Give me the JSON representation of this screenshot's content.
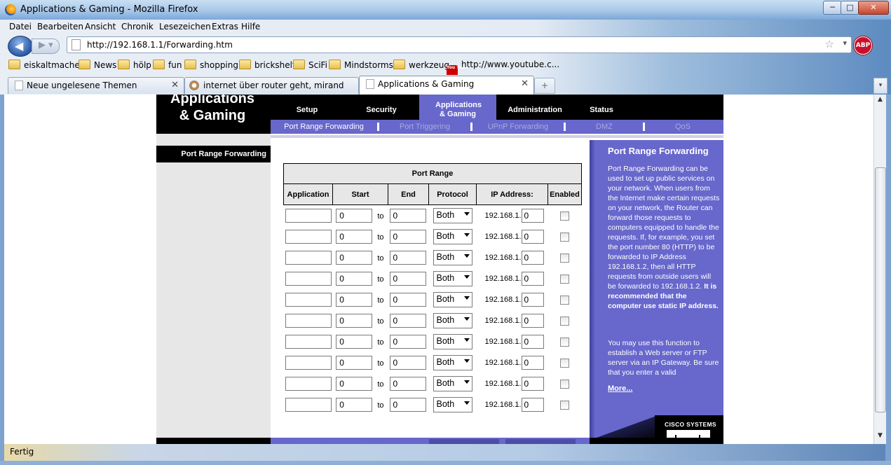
{
  "window": {
    "title": "Applications & Gaming - Mozilla Firefox",
    "min_label": "─",
    "max_label": "□",
    "close_label": "✕"
  },
  "menu": [
    "Datei",
    "Bearbeiten",
    "Ansicht",
    "Chronik",
    "Lesezeichen",
    "Extras",
    "Hilfe"
  ],
  "navbar": {
    "url": "http://192.168.1.1/Forwarding.htm",
    "adblock_label": "ABP"
  },
  "bookmarks": [
    {
      "label": "eiskaltmacher",
      "icon": "folder-icon"
    },
    {
      "label": "News",
      "icon": "folder-icon"
    },
    {
      "label": "hölp",
      "icon": "folder-icon"
    },
    {
      "label": "fun",
      "icon": "folder-icon"
    },
    {
      "label": "shopping",
      "icon": "folder-icon"
    },
    {
      "label": "brickshelf",
      "icon": "folder-icon"
    },
    {
      "label": "SciFi",
      "icon": "folder-icon"
    },
    {
      "label": "Mindstorms",
      "icon": "folder-icon"
    },
    {
      "label": "werkzeug",
      "icon": "folder-icon"
    },
    {
      "label": "http://www.youtube.c...",
      "icon": "youtube-icon"
    }
  ],
  "youtube_icon_text": "You Tube",
  "tabs": [
    {
      "label": "Neue ungelesene Themen",
      "active": false
    },
    {
      "label": "internet über router geht, miranda a...",
      "active": false
    },
    {
      "label": "Applications & Gaming",
      "active": true
    }
  ],
  "new_tab_label": "+",
  "status": "Fertig",
  "router": {
    "section_title": "Applications & Gaming",
    "main_tabs": [
      "Setup",
      "Security",
      "Applications & Gaming",
      "Administration",
      "Status"
    ],
    "active_main_tab": "Applications & Gaming",
    "sub_tabs": [
      "Port Range Forwarding",
      "Port Triggering",
      "UPnP Forwarding",
      "DMZ",
      "QoS"
    ],
    "active_sub_tab": "Port Range Forwarding",
    "left_label": "Port Range Forwarding",
    "table": {
      "group_header": "Port Range",
      "headers": [
        "Application",
        "Start",
        "End",
        "Protocol",
        "IP Address:",
        "Enabled"
      ],
      "to_label": "to",
      "ip_prefix": "192.168.1.",
      "rows": [
        {
          "application": "",
          "start": "0",
          "end": "0",
          "protocol": "Both",
          "ip_last": "0",
          "enabled": false
        },
        {
          "application": "",
          "start": "0",
          "end": "0",
          "protocol": "Both",
          "ip_last": "0",
          "enabled": false
        },
        {
          "application": "",
          "start": "0",
          "end": "0",
          "protocol": "Both",
          "ip_last": "0",
          "enabled": false
        },
        {
          "application": "",
          "start": "0",
          "end": "0",
          "protocol": "Both",
          "ip_last": "0",
          "enabled": false
        },
        {
          "application": "",
          "start": "0",
          "end": "0",
          "protocol": "Both",
          "ip_last": "0",
          "enabled": false
        },
        {
          "application": "",
          "start": "0",
          "end": "0",
          "protocol": "Both",
          "ip_last": "0",
          "enabled": false
        },
        {
          "application": "",
          "start": "0",
          "end": "0",
          "protocol": "Both",
          "ip_last": "0",
          "enabled": false
        },
        {
          "application": "",
          "start": "0",
          "end": "0",
          "protocol": "Both",
          "ip_last": "0",
          "enabled": false
        },
        {
          "application": "",
          "start": "0",
          "end": "0",
          "protocol": "Both",
          "ip_last": "0",
          "enabled": false
        },
        {
          "application": "",
          "start": "0",
          "end": "0",
          "protocol": "Both",
          "ip_last": "0",
          "enabled": false
        }
      ]
    },
    "help": {
      "title": "Port Range Forwarding",
      "body": "Port Range Forwarding can be used to set up public services on your network. When users from the Internet make certain requests on your network, the Router can forward those requests to computers equipped to handle the requests. If, for example, you set the port number 80 (HTTP) to be forwarded to IP Address 192.168.1.2, then all HTTP requests from outside users will be forwarded to 192.168.1.2. ",
      "body_bold": "It is recommended that the computer use static IP address.",
      "body2": "You may use this function to establish a Web server or FTP server via an IP Gateway. Be sure that you enter a valid",
      "more": "More..."
    },
    "brand": "Cisco Systems"
  },
  "colors": {
    "accent_purple": "#6767cc",
    "nav_black": "#000000"
  }
}
